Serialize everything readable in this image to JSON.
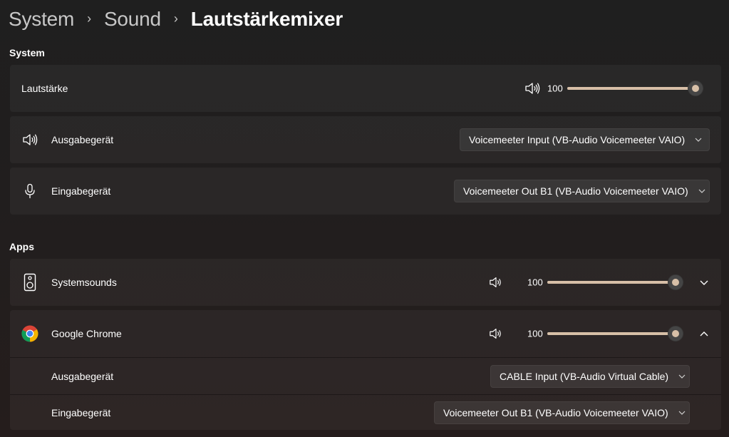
{
  "breadcrumb": {
    "items": [
      "System",
      "Sound"
    ],
    "current": "Lautstärkemixer",
    "separator": "›"
  },
  "system_section": {
    "title": "System",
    "volume": {
      "label": "Lautstärke",
      "value": "100",
      "level_percent": 100,
      "icon": "speaker-icon"
    },
    "output": {
      "label": "Ausgabegerät",
      "icon": "speaker-icon",
      "selected": "Voicemeeter Input (VB-Audio Voicemeeter VAIO)"
    },
    "input": {
      "label": "Eingabegerät",
      "icon": "microphone-icon",
      "selected": "Voicemeeter Out B1 (VB-Audio Voicemeeter VAIO)"
    }
  },
  "apps_section": {
    "title": "Apps",
    "apps": [
      {
        "name": "Systemsounds",
        "icon": "system-sounds-speaker-icon",
        "value": "100",
        "level_percent": 100,
        "expanded": false
      },
      {
        "name": "Google Chrome",
        "icon": "chrome-icon",
        "value": "100",
        "level_percent": 100,
        "expanded": true,
        "output": {
          "label": "Ausgabegerät",
          "selected": "CABLE Input (VB-Audio Virtual Cable)"
        },
        "input": {
          "label": "Eingabegerät",
          "selected": "Voicemeeter Out B1 (VB-Audio Voicemeeter VAIO)"
        }
      }
    ]
  },
  "colors": {
    "accent": "#d7bfa7",
    "track": "#6b6460",
    "card": "#2b2b2b"
  }
}
